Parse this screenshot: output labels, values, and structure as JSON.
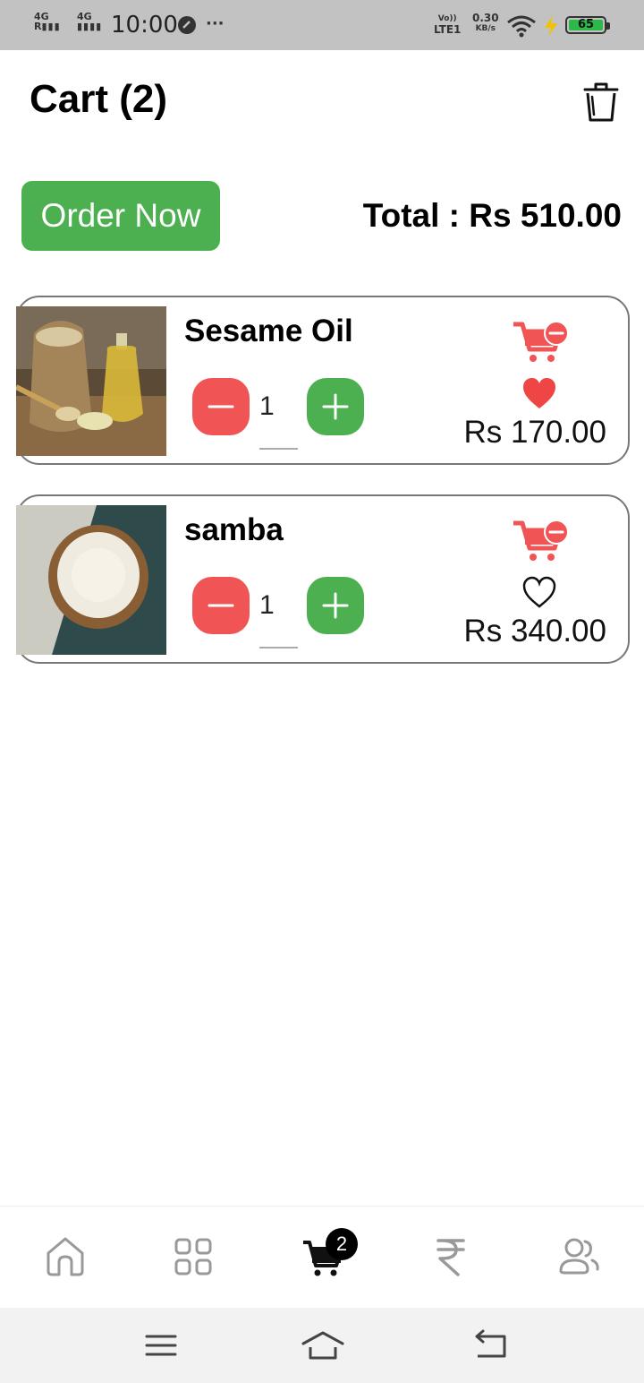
{
  "status_bar": {
    "network_1": "4G",
    "network_2": "4G",
    "time": "10:00",
    "more": "···",
    "volte": "Vo))",
    "lte": "LTE1",
    "speed": "0.30",
    "speed_unit": "KB/s",
    "battery": "65",
    "battery_color": "#2fb84a"
  },
  "header": {
    "title": "Cart (2)",
    "trash_icon": "trash-icon"
  },
  "order_bar": {
    "order_button_label": "Order Now",
    "total": "Total : Rs 510.00"
  },
  "cart_items": [
    {
      "name": "Sesame Oil",
      "quantity": "1",
      "price": "Rs 170.00",
      "favorite": true
    },
    {
      "name": "samba",
      "quantity": "1",
      "price": "Rs 340.00",
      "favorite": false
    }
  ],
  "bottom_nav": {
    "items": [
      "home-icon",
      "grid-icon",
      "cart-icon",
      "rupee-icon",
      "users-icon"
    ],
    "active": "cart-icon",
    "cart_badge": "2"
  },
  "colors": {
    "accent_green": "#4caf50",
    "accent_red": "#f05454"
  }
}
